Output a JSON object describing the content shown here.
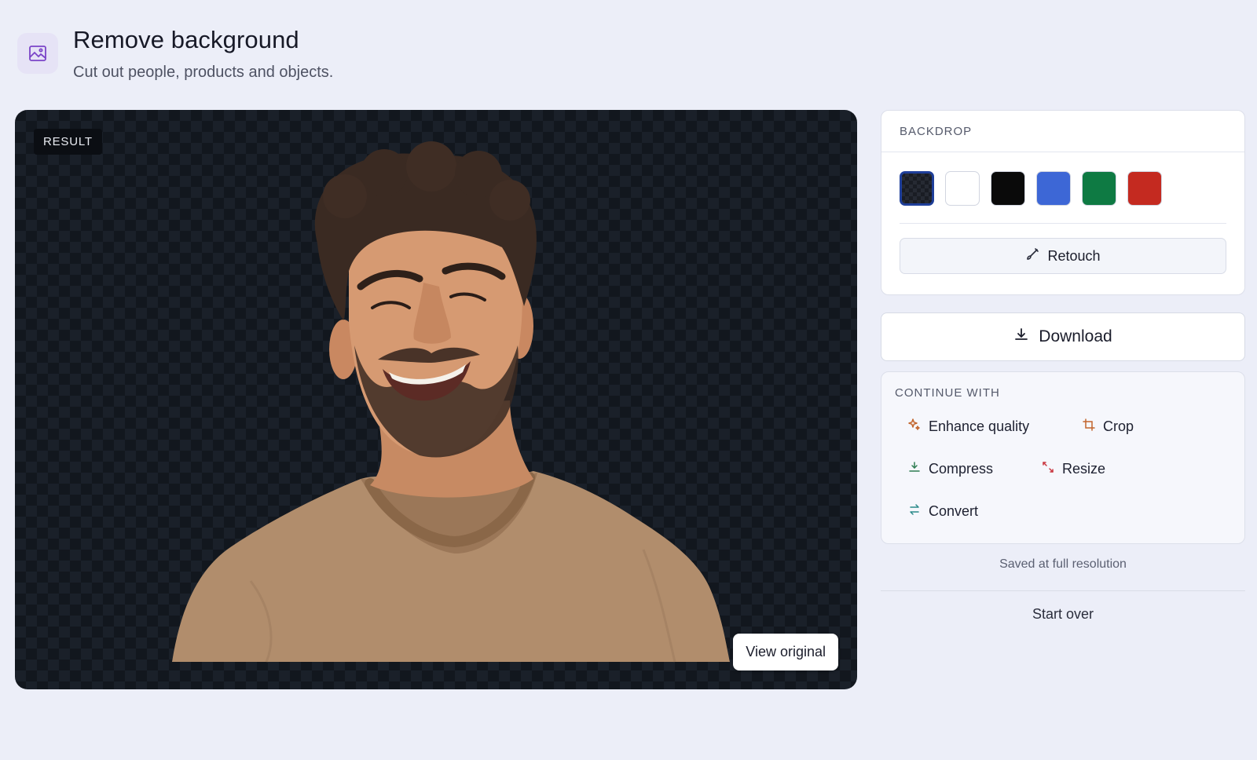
{
  "header": {
    "icon": "image-icon",
    "title": "Remove background",
    "subtitle": "Cut out people, products and objects."
  },
  "canvas": {
    "badge": "RESULT",
    "view_original_label": "View original"
  },
  "backdrop": {
    "header": "BACKDROP",
    "swatches": [
      {
        "name": "transparent",
        "color": "#1a1d24",
        "selected": true
      },
      {
        "name": "white",
        "color": "#ffffff",
        "selected": false
      },
      {
        "name": "black",
        "color": "#0a0a0a",
        "selected": false
      },
      {
        "name": "blue",
        "color": "#3d67d6",
        "selected": false
      },
      {
        "name": "green",
        "color": "#0e7a43",
        "selected": false
      },
      {
        "name": "red",
        "color": "#c42a20",
        "selected": false
      }
    ],
    "retouch_label": "Retouch",
    "retouch_icon": "brush-icon"
  },
  "download": {
    "label": "Download",
    "icon": "download-icon"
  },
  "continue_with": {
    "header": "CONTINUE WITH",
    "actions": [
      {
        "label": "Enhance quality",
        "icon": "sparkle-icon",
        "color": "#c2652d"
      },
      {
        "label": "Crop",
        "icon": "crop-icon",
        "color": "#c2652d"
      },
      {
        "label": "Compress",
        "icon": "compress-icon",
        "color": "#2f7d52"
      },
      {
        "label": "Resize",
        "icon": "resize-icon",
        "color": "#c9353e"
      },
      {
        "label": "Convert",
        "icon": "convert-icon",
        "color": "#2a8a8a"
      }
    ]
  },
  "footer": {
    "saved_note": "Saved at full resolution",
    "start_over_label": "Start over"
  },
  "colors": {
    "background": "#eceef8",
    "accent": "#1f3f9a"
  }
}
